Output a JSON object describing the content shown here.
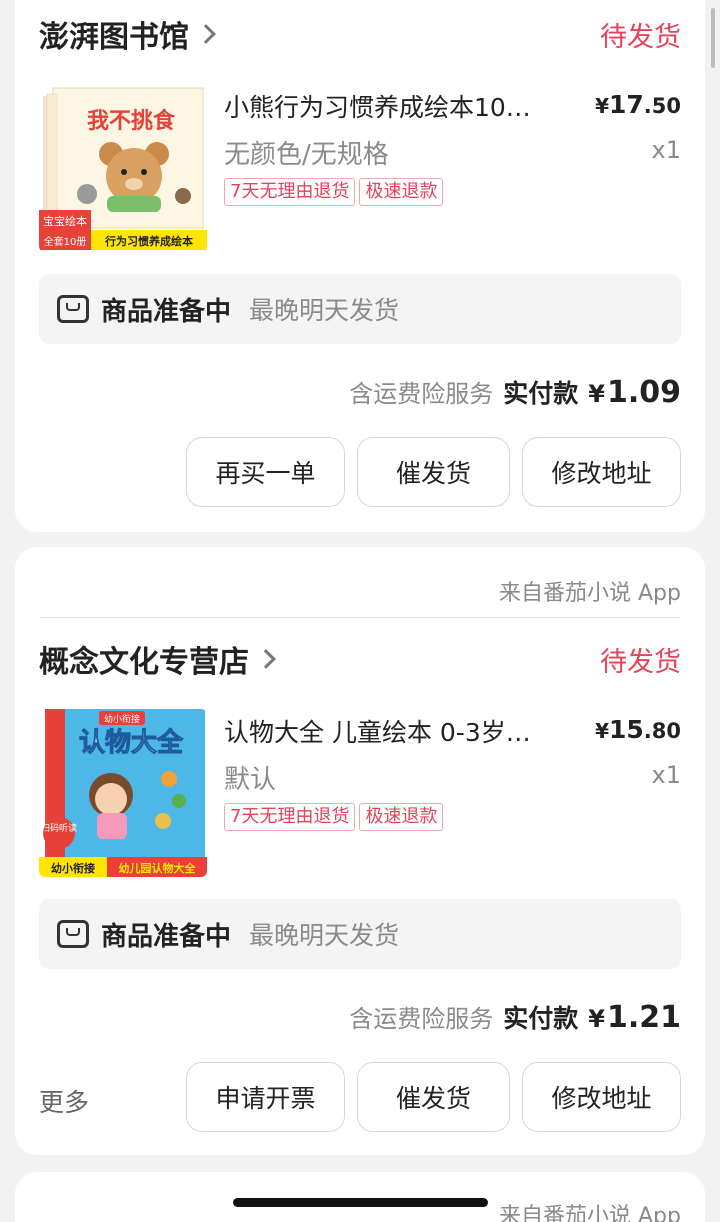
{
  "orders": [
    {
      "shop": "澎湃图书馆",
      "status": "待发货",
      "product": {
        "title": "小熊行为习惯养成绘本10…",
        "price_currency": "¥",
        "price_int": "17",
        "price_dec": ".50",
        "spec": "无颜色/无规格",
        "qty": "x1",
        "tags": [
          "7天无理由退货",
          "极速退款"
        ],
        "cover": {
          "title": "我不挑食",
          "badge1": "宝宝绘本",
          "badge2": "全套10册",
          "banner": "行为习惯养成绘本"
        }
      },
      "prep": {
        "title": "商品准备中",
        "sub": "最晚明天发货"
      },
      "payment": {
        "service": "含运费险服务",
        "label": "实付款",
        "currency": "¥",
        "amount": "1.09"
      },
      "buttons": [
        "再买一单",
        "催发货",
        "修改地址"
      ]
    },
    {
      "source": "来自番茄小说 App",
      "shop": "概念文化专营店",
      "status": "待发货",
      "product": {
        "title": "认物大全 儿童绘本 0-3岁…",
        "price_currency": "¥",
        "price_int": "15",
        "price_dec": ".80",
        "spec": "默认",
        "qty": "x1",
        "tags": [
          "7天无理由退货",
          "极速退款"
        ],
        "cover": {
          "title": "认物大全",
          "top": "幼小衔接",
          "badge": "扫码听读",
          "banner1": "幼小衔接",
          "banner2": "幼儿园认物大全"
        }
      },
      "prep": {
        "title": "商品准备中",
        "sub": "最晚明天发货"
      },
      "payment": {
        "service": "含运费险服务",
        "label": "实付款",
        "currency": "¥",
        "amount": "1.21"
      },
      "more": "更多",
      "buttons": [
        "申请开票",
        "催发货",
        "修改地址"
      ]
    },
    {
      "source": "来自番茄小说 App"
    }
  ]
}
